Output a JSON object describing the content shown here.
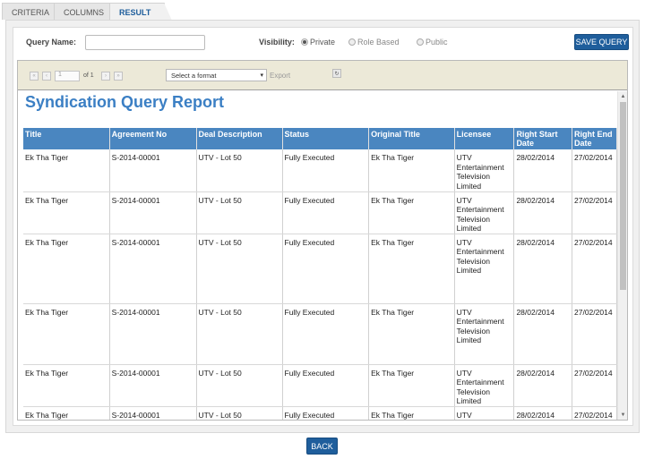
{
  "tabs": [
    "CRITERIA",
    "COLUMNS",
    "RESULT"
  ],
  "form": {
    "query_name_label": "Query Name:",
    "query_name_value": "",
    "visibility_label": "Visibility:",
    "visibility_options": [
      "Private",
      "Role Based",
      "Public"
    ],
    "visibility_selected": "Private",
    "save_button": "SAVE QUERY"
  },
  "toolbar": {
    "first": "«",
    "prev": "‹",
    "page_value": "1",
    "of_text": "of 1",
    "next": "›",
    "last": "»",
    "format_placeholder": "Select a format",
    "format_arrow": "▾",
    "export_label": "Export",
    "refresh_symbol": "↻"
  },
  "report": {
    "title": "Syndication Query Report",
    "columns": [
      "Title",
      "Agreement No",
      "Deal Description",
      "Status",
      "Original Title",
      "Licensee",
      "Right Start Date",
      "Right End Date"
    ],
    "rows": [
      [
        "Ek Tha Tiger",
        "S-2014-00001",
        "UTV - Lot 50",
        "Fully Executed",
        "Ek Tha Tiger",
        "UTV Entertainment Television Limited",
        "28/02/2014",
        "27/02/2014"
      ],
      [
        "Ek Tha Tiger",
        "S-2014-00001",
        "UTV - Lot 50",
        "Fully Executed",
        "Ek Tha Tiger",
        "UTV Entertainment Television Limited",
        "28/02/2014",
        "27/02/2014"
      ],
      [
        "Ek Tha Tiger",
        "S-2014-00001",
        "UTV - Lot 50",
        "Fully Executed",
        "Ek Tha Tiger",
        "UTV Entertainment Television Limited",
        "28/02/2014",
        "27/02/2014"
      ],
      [
        "Ek Tha Tiger",
        "S-2014-00001",
        "UTV - Lot 50",
        "Fully Executed",
        "Ek Tha Tiger",
        "UTV Entertainment Television Limited",
        "28/02/2014",
        "27/02/2014"
      ],
      [
        "Ek Tha Tiger",
        "S-2014-00001",
        "UTV - Lot 50",
        "Fully Executed",
        "Ek Tha Tiger",
        "UTV Entertainment Television Limited",
        "28/02/2014",
        "27/02/2014"
      ],
      [
        "Ek Tha Tiger",
        "S-2014-00001",
        "UTV - Lot 50",
        "Fully Executed",
        "Ek Tha Tiger",
        "UTV",
        "28/02/2014",
        "27/02/2014"
      ]
    ]
  },
  "back_button": "BACK",
  "colors": {
    "accent": "#1f5e9c",
    "header_bg": "#4a86c0",
    "title_color": "#3b7fc4",
    "toolbar_bg": "#ece9d8"
  },
  "icons": {
    "first": "first-page-icon",
    "prev": "prev-page-icon",
    "next": "next-page-icon",
    "last": "last-page-icon",
    "refresh": "refresh-icon",
    "dropdown": "chevron-down-icon",
    "scroll_up": "scroll-up-arrow-icon",
    "scroll_down": "scroll-down-arrow-icon"
  }
}
